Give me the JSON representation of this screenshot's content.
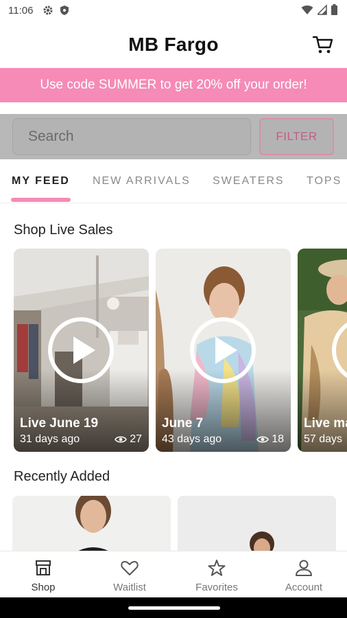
{
  "status_bar": {
    "time": "11:06"
  },
  "header": {
    "title": "MB Fargo"
  },
  "promo": {
    "text": "Use code SUMMER to get 20% off your order!"
  },
  "search": {
    "placeholder": "Search",
    "filter_label": "FILTER"
  },
  "tabs": [
    {
      "label": "MY FEED",
      "active": true
    },
    {
      "label": "NEW ARRIVALS",
      "active": false
    },
    {
      "label": "SWEATERS",
      "active": false
    },
    {
      "label": "TOPS",
      "active": false
    }
  ],
  "live_sales": {
    "title": "Shop Live Sales",
    "cards": [
      {
        "title": "Live June 19",
        "subtitle": "31 days ago",
        "views": "27"
      },
      {
        "title": "June 7",
        "subtitle": "43 days ago",
        "views": "18"
      },
      {
        "title": "Live ma",
        "subtitle": "57 days",
        "views": ""
      }
    ]
  },
  "recently_added": {
    "title": "Recently Added"
  },
  "bottom_nav": [
    {
      "label": "Shop",
      "icon": "shop-icon",
      "active": true
    },
    {
      "label": "Waitlist",
      "icon": "heart-icon",
      "active": false
    },
    {
      "label": "Favorites",
      "icon": "star-icon",
      "active": false
    },
    {
      "label": "Account",
      "icon": "account-icon",
      "active": false
    }
  ],
  "colors": {
    "accent": "#f58bb6",
    "filter_text": "#c45b86"
  }
}
